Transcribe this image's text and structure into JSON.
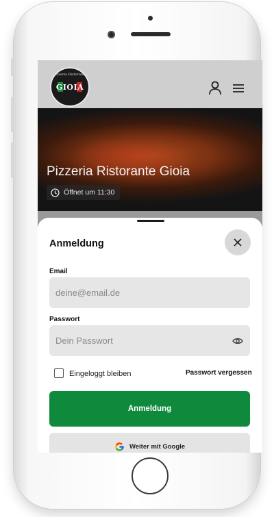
{
  "header": {
    "logo_text": "GIOIA",
    "logo_arc_text": "Pizzeria Ristorante"
  },
  "hero": {
    "title": "Pizzeria Ristorante Gioia",
    "hours": "Öffnet um 11:30"
  },
  "login": {
    "title": "Anmeldung",
    "email_label": "Email",
    "email_placeholder": "deine@email.de",
    "password_label": "Passwort",
    "password_placeholder": "Dein Passwort",
    "remember_label": "Eingeloggt bleiben",
    "remember_checked": false,
    "forgot_label": "Passwort vergessen",
    "submit_label": "Anmeldung",
    "google_label": "Weiter mit Google"
  },
  "colors": {
    "accent_green": "#0f8a3d",
    "topbar_gray": "#cfcfcf"
  },
  "icons": [
    "user-icon",
    "menu-icon",
    "clock-icon",
    "close-icon",
    "eye-icon",
    "google-icon"
  ]
}
